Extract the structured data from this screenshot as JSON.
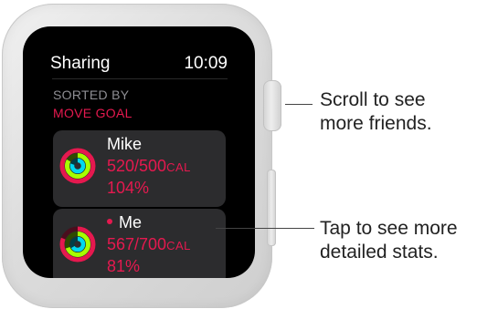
{
  "watch": {
    "app_title": "Sharing",
    "time": "10:09",
    "sort_label": "SORTED BY",
    "sort_value": "MOVE GOAL",
    "friends": [
      {
        "name": "Mike",
        "calories": "520/500",
        "unit": "CAL",
        "percent": "104%",
        "is_me": false,
        "move_progress": 1.04
      },
      {
        "name": "Me",
        "calories": "567/700",
        "unit": "CAL",
        "percent": "81%",
        "is_me": true,
        "move_progress": 0.81
      }
    ]
  },
  "callouts": {
    "crown": {
      "line1": "Scroll to see",
      "line2": "more friends."
    },
    "card": {
      "line1": "Tap to see more",
      "line2": "detailed stats."
    }
  },
  "colors": {
    "move": "#e5194f",
    "exercise": "#a6ff00",
    "stand": "#00d8f0",
    "card_bg": "#2c2c2e"
  }
}
